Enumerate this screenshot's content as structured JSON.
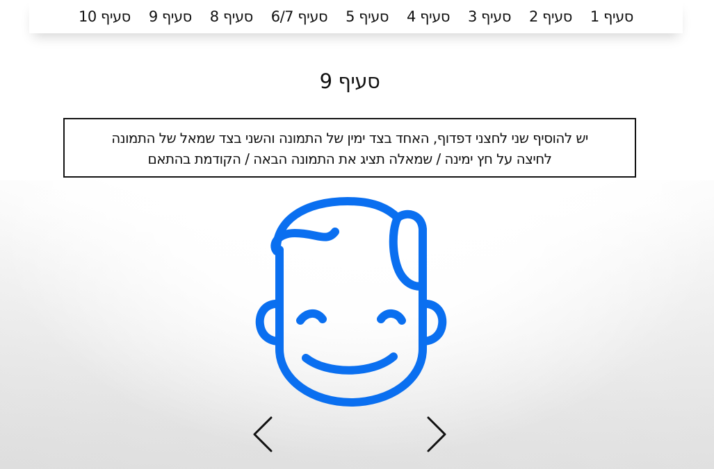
{
  "nav": {
    "items": [
      {
        "label": "סעיף 1"
      },
      {
        "label": "סעיף 2"
      },
      {
        "label": "סעיף 3"
      },
      {
        "label": "סעיף 4"
      },
      {
        "label": "סעיף 5"
      },
      {
        "label": "סעיף 6/7"
      },
      {
        "label": "סעיף 8"
      },
      {
        "label": "סעיף 9"
      },
      {
        "label": "סעיף 10"
      }
    ]
  },
  "main": {
    "title": "סעיף 9",
    "instructions": {
      "line1": "יש להוסיף שני לחצני דפדוף, האחד בצד ימין של התמונה והשני בצד שמאל של התמונה",
      "line2": "לחיצה על חץ ימינה / שמאלה תציג את התמונה הבאה / הקודמת בהתאם"
    }
  },
  "slider": {
    "image_icon": "smiling-boy-face-icon",
    "prev_icon": "chevron-left-icon",
    "next_icon": "chevron-right-icon"
  },
  "colors": {
    "face_stroke": "#0a6ff0",
    "text": "#111111",
    "border": "#111111"
  }
}
